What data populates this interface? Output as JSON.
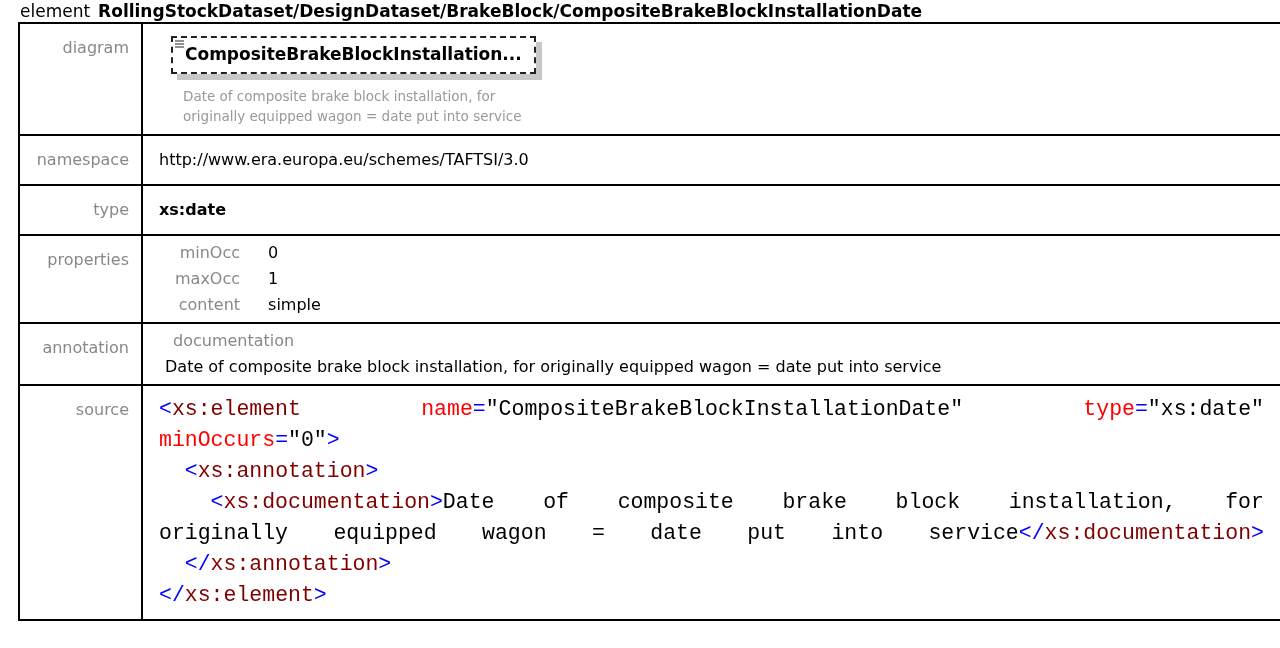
{
  "heading": {
    "label": "element",
    "path": "RollingStockDataset/DesignDataset/BrakeBlock/CompositeBrakeBlockInstallationDate"
  },
  "rows": [
    {
      "kind": "diagram",
      "label": "diagram",
      "element_name": "CompositeBrakeBlockInstallation...",
      "description": "Date of composite brake block installation, for originally equipped wagon = date put into service"
    },
    {
      "kind": "text",
      "label": "namespace",
      "value": "http://www.era.europa.eu/schemes/TAFTSI/3.0"
    },
    {
      "kind": "bold",
      "label": "type",
      "value": "xs:date"
    },
    {
      "kind": "properties",
      "label": "properties",
      "items": [
        {
          "name": "minOcc",
          "value": "0"
        },
        {
          "name": "maxOcc",
          "value": "1"
        },
        {
          "name": "content",
          "value": "simple"
        }
      ]
    },
    {
      "kind": "annotation",
      "label": "annotation",
      "title": "documentation",
      "text": "Date of composite brake block installation, for originally equipped wagon = date put into service"
    },
    {
      "kind": "source",
      "label": "source",
      "lines": [
        {
          "justify": true,
          "words": [
            [
              {
                "kind": "p",
                "t": "<"
              },
              {
                "kind": "tag",
                "t": "xs:element"
              }
            ],
            [
              {
                "kind": "attr",
                "t": "name"
              },
              {
                "kind": "p",
                "t": "="
              },
              {
                "kind": "val",
                "t": "\"CompositeBrakeBlockInstallationDate\""
              }
            ],
            [
              {
                "kind": "attr",
                "t": "type"
              },
              {
                "kind": "p",
                "t": "="
              },
              {
                "kind": "val",
                "t": "\"xs:date\""
              }
            ]
          ]
        },
        {
          "justify": false,
          "words": [
            [
              {
                "kind": "attr",
                "t": "minOccurs"
              },
              {
                "kind": "p",
                "t": "="
              },
              {
                "kind": "val",
                "t": "\"0\""
              },
              {
                "kind": "p",
                "t": ">"
              }
            ]
          ]
        },
        {
          "justify": false,
          "words": [
            [
              {
                "kind": "p",
                "t": "  <"
              },
              {
                "kind": "tag",
                "t": "xs:annotation"
              },
              {
                "kind": "p",
                "t": ">"
              }
            ]
          ]
        },
        {
          "justify": true,
          "words": [
            [
              {
                "kind": "p",
                "t": "    <"
              },
              {
                "kind": "tag",
                "t": "xs:documentation"
              },
              {
                "kind": "p",
                "t": ">"
              },
              {
                "kind": "val",
                "t": "Date"
              }
            ],
            [
              {
                "kind": "val",
                "t": "of"
              }
            ],
            [
              {
                "kind": "val",
                "t": "composite"
              }
            ],
            [
              {
                "kind": "val",
                "t": "brake"
              }
            ],
            [
              {
                "kind": "val",
                "t": "block"
              }
            ],
            [
              {
                "kind": "val",
                "t": "installation,"
              }
            ],
            [
              {
                "kind": "val",
                "t": "for"
              }
            ]
          ]
        },
        {
          "justify": true,
          "words": [
            [
              {
                "kind": "val",
                "t": "originally"
              }
            ],
            [
              {
                "kind": "val",
                "t": "equipped"
              }
            ],
            [
              {
                "kind": "val",
                "t": "wagon"
              }
            ],
            [
              {
                "kind": "val",
                "t": "="
              }
            ],
            [
              {
                "kind": "val",
                "t": "date"
              }
            ],
            [
              {
                "kind": "val",
                "t": "put"
              }
            ],
            [
              {
                "kind": "val",
                "t": "into"
              }
            ],
            [
              {
                "kind": "val",
                "t": "service"
              },
              {
                "kind": "p",
                "t": "</"
              },
              {
                "kind": "tag",
                "t": "xs:documentation"
              },
              {
                "kind": "p",
                "t": ">"
              }
            ]
          ]
        },
        {
          "justify": false,
          "words": [
            [
              {
                "kind": "p",
                "t": "  </"
              },
              {
                "kind": "tag",
                "t": "xs:annotation"
              },
              {
                "kind": "p",
                "t": ">"
              }
            ]
          ]
        },
        {
          "justify": false,
          "words": [
            [
              {
                "kind": "p",
                "t": "</"
              },
              {
                "kind": "tag",
                "t": "xs:element"
              },
              {
                "kind": "p",
                "t": ">"
              }
            ]
          ]
        }
      ]
    }
  ]
}
